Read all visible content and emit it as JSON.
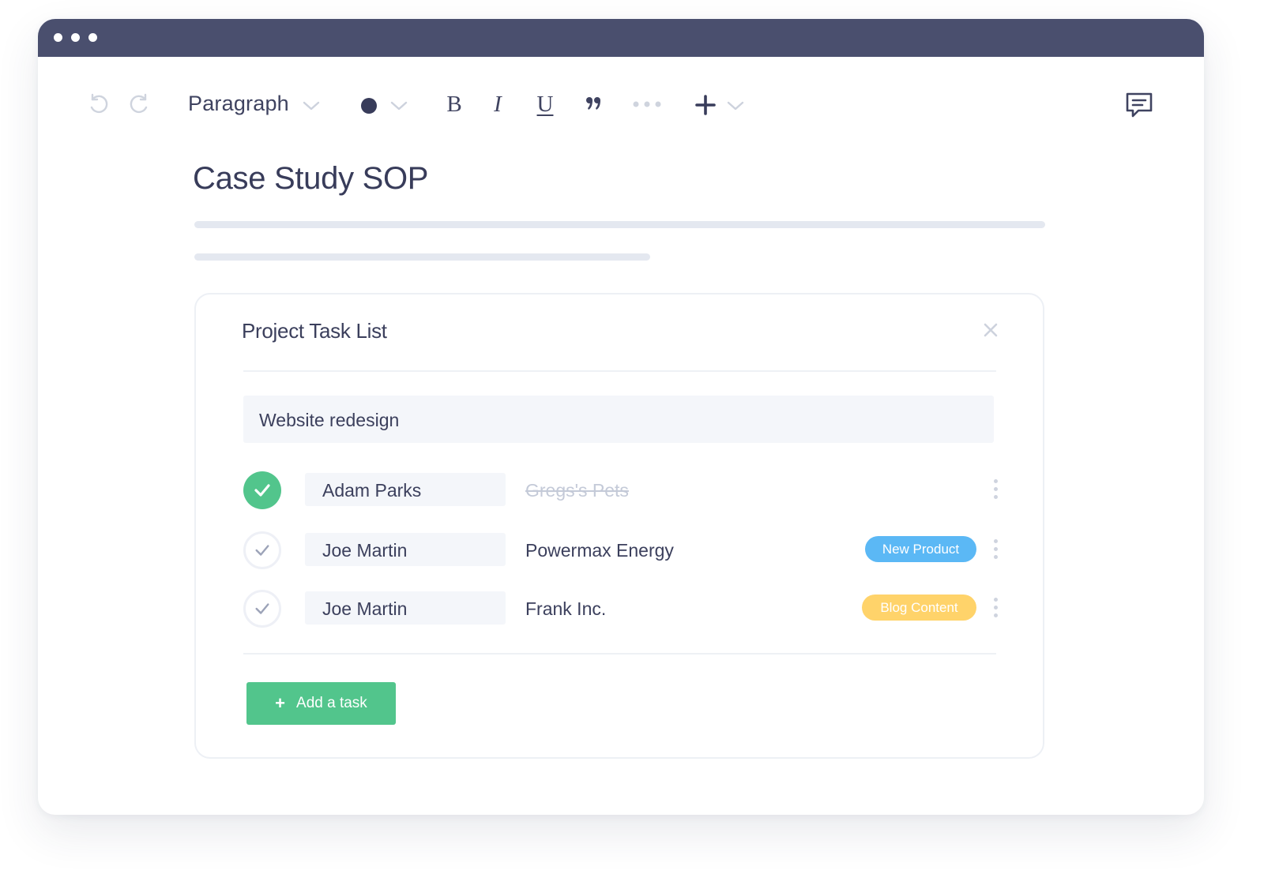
{
  "toolbar": {
    "block_format": "Paragraph",
    "text_color": "#383c5a",
    "icons": [
      "undo-icon",
      "redo-icon",
      "chevron-down-icon",
      "color-dot-icon",
      "bold-icon",
      "italic-icon",
      "underline-icon",
      "quote-icon",
      "more-icon",
      "plus-icon",
      "comment-icon"
    ],
    "bold_label": "B",
    "italic_label": "I",
    "underline_label": "U"
  },
  "document": {
    "title": "Case Study SOP"
  },
  "task_list": {
    "title": "Project Task List",
    "project": "Website redesign",
    "tasks": [
      {
        "completed": true,
        "assignee": "Adam Parks",
        "name": "Gregs's Pets",
        "tag": ""
      },
      {
        "completed": false,
        "assignee": "Joe Martin",
        "name": "Powermax Energy",
        "tag": "New Product"
      },
      {
        "completed": false,
        "assignee": "Joe Martin",
        "name": "Frank Inc.",
        "tag": "Blog Content"
      }
    ],
    "add_button": "Add a task",
    "add_button_icon": "+"
  },
  "colors": {
    "titlebar": "#4a4f6e",
    "accent_green": "#52c58c",
    "tag_new_product": "#5bb8f5",
    "tag_blog_content": "#ffd36a"
  }
}
